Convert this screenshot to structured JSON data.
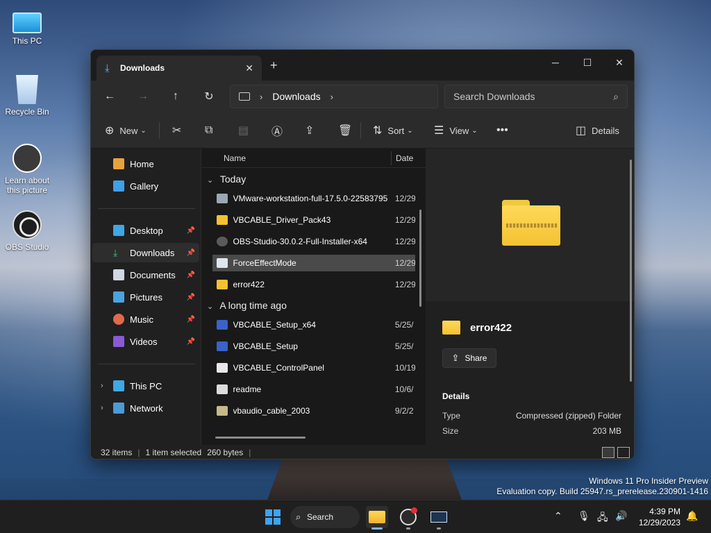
{
  "desktop": {
    "icons": [
      {
        "label": "This PC"
      },
      {
        "label": "Recycle Bin"
      },
      {
        "label": "Learn about this picture"
      },
      {
        "label": "OBS Studio"
      }
    ]
  },
  "window": {
    "tab_title": "Downloads",
    "address": {
      "crumb": "Downloads"
    },
    "search_placeholder": "Search Downloads",
    "toolbar": {
      "new_label": "New",
      "sort_label": "Sort",
      "view_label": "View",
      "details_label": "Details"
    },
    "sidebar": {
      "items": [
        {
          "label": "Home"
        },
        {
          "label": "Gallery"
        },
        {
          "label": "Desktop"
        },
        {
          "label": "Downloads"
        },
        {
          "label": "Documents"
        },
        {
          "label": "Pictures"
        },
        {
          "label": "Music"
        },
        {
          "label": "Videos"
        },
        {
          "label": "This PC"
        },
        {
          "label": "Network"
        }
      ]
    },
    "columns": {
      "name": "Name",
      "date": "Date"
    },
    "groups": [
      {
        "label": "Today",
        "files": [
          {
            "name": "VMware-workstation-full-17.5.0-22583795",
            "date": "12/29"
          },
          {
            "name": "VBCABLE_Driver_Pack43",
            "date": "12/29"
          },
          {
            "name": "OBS-Studio-30.0.2-Full-Installer-x64",
            "date": "12/29"
          },
          {
            "name": "ForceEffectMode",
            "date": "12/29"
          },
          {
            "name": "error422",
            "date": "12/29"
          }
        ]
      },
      {
        "label": "A long time ago",
        "files": [
          {
            "name": "VBCABLE_Setup_x64",
            "date": "5/25/"
          },
          {
            "name": "VBCABLE_Setup",
            "date": "5/25/"
          },
          {
            "name": "VBCABLE_ControlPanel",
            "date": "10/19"
          },
          {
            "name": "readme",
            "date": "10/6/"
          },
          {
            "name": "vbaudio_cable_2003",
            "date": "9/2/2"
          }
        ]
      }
    ],
    "details": {
      "title": "error422",
      "share_label": "Share",
      "section": "Details",
      "props": [
        {
          "key": "Type",
          "value": "Compressed (zipped) Folder"
        },
        {
          "key": "Size",
          "value": "203 MB"
        }
      ]
    },
    "status": {
      "items": "32 items",
      "selected": "1 item selected",
      "size": "260 bytes"
    }
  },
  "watermark": {
    "line1": "Windows 11 Pro Insider Preview",
    "line2": "Evaluation copy. Build 25947.rs_prerelease.230901-1416"
  },
  "taskbar": {
    "search_label": "Search",
    "time": "4:39 PM",
    "date": "12/29/2023"
  }
}
